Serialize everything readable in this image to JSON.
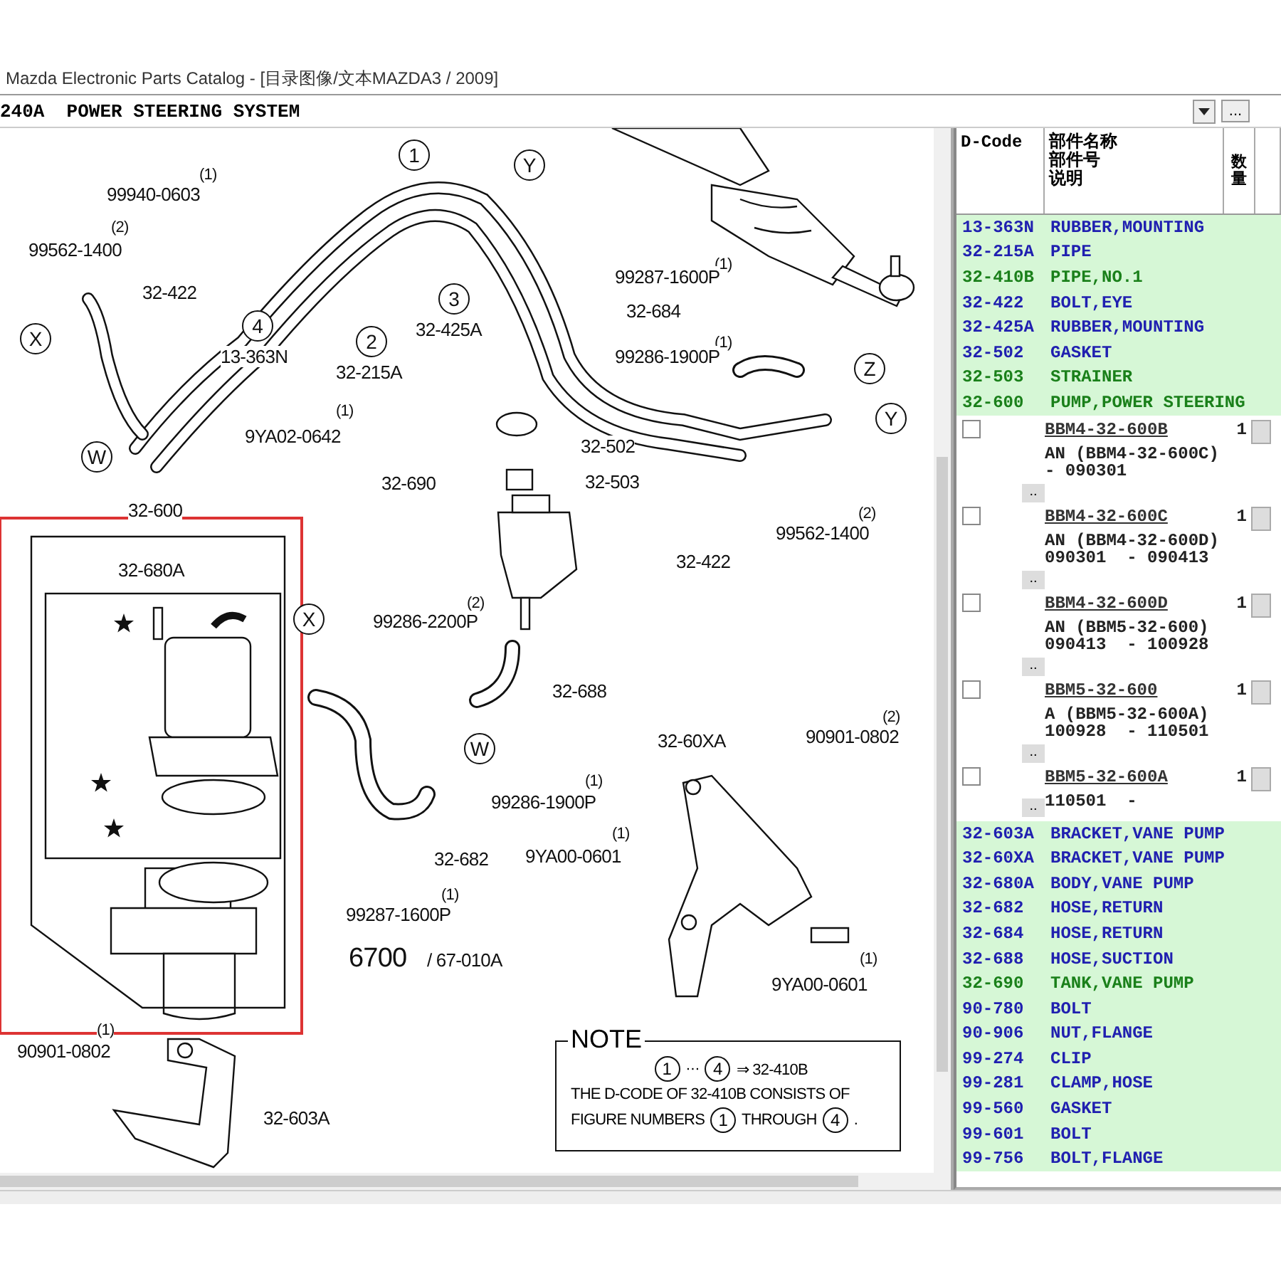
{
  "window": {
    "title": "Mazda Electronic Parts Catalog - [目录图像/文本MAZDA3 / 2009]"
  },
  "section": {
    "title": "240A  POWER STEERING SYSTEM",
    "more": "..."
  },
  "diagram": {
    "labels": [
      {
        "kind": "qty",
        "text": "(1)"
      },
      {
        "kind": "part",
        "text": "99940-0603"
      },
      {
        "kind": "qty",
        "text": "(2)"
      },
      {
        "kind": "part",
        "text": "99562-1400"
      },
      {
        "kind": "part",
        "text": "32-422"
      },
      {
        "kind": "callout",
        "text": "X"
      },
      {
        "kind": "callout",
        "text": "1"
      },
      {
        "kind": "callout",
        "text": "Y"
      },
      {
        "kind": "callout",
        "text": "4"
      },
      {
        "kind": "part",
        "text": "13-363N"
      },
      {
        "kind": "callout",
        "text": "3"
      },
      {
        "kind": "part",
        "text": "32-425A"
      },
      {
        "kind": "callout",
        "text": "2"
      },
      {
        "kind": "part",
        "text": "32-215A"
      },
      {
        "kind": "qty",
        "text": "(1)"
      },
      {
        "kind": "part",
        "text": "9YA02-0642"
      },
      {
        "kind": "callout",
        "text": "W"
      },
      {
        "kind": "qty",
        "text": "(1)"
      },
      {
        "kind": "part",
        "text": "99287-1600P"
      },
      {
        "kind": "part",
        "text": "32-684"
      },
      {
        "kind": "qty",
        "text": "(1)"
      },
      {
        "kind": "part",
        "text": "99286-1900P"
      },
      {
        "kind": "callout",
        "text": "Z"
      },
      {
        "kind": "callout",
        "text": "Y"
      },
      {
        "kind": "part",
        "text": "32-502"
      },
      {
        "kind": "part",
        "text": "32-503"
      },
      {
        "kind": "part",
        "text": "32-690"
      },
      {
        "kind": "part",
        "text": "32-422"
      },
      {
        "kind": "qty",
        "text": "(2)"
      },
      {
        "kind": "part",
        "text": "99562-1400"
      },
      {
        "kind": "part",
        "text": "32-600"
      },
      {
        "kind": "part",
        "text": "32-680A"
      },
      {
        "kind": "callout",
        "text": "X"
      },
      {
        "kind": "qty",
        "text": "(2)"
      },
      {
        "kind": "part",
        "text": "99286-2200P"
      },
      {
        "kind": "part",
        "text": "32-688"
      },
      {
        "kind": "callout",
        "text": "W"
      },
      {
        "kind": "qty",
        "text": "(1)"
      },
      {
        "kind": "part",
        "text": "99286-1900P"
      },
      {
        "kind": "part",
        "text": "32-682"
      },
      {
        "kind": "qty",
        "text": "(1)"
      },
      {
        "kind": "part",
        "text": "99287-1600P"
      },
      {
        "kind": "ref",
        "text": "6700"
      },
      {
        "kind": "part",
        "text": "/ 67-010A"
      },
      {
        "kind": "part",
        "text": "32-60XA"
      },
      {
        "kind": "qty",
        "text": "(2)"
      },
      {
        "kind": "part",
        "text": "90901-0802"
      },
      {
        "kind": "qty",
        "text": "(1)"
      },
      {
        "kind": "part",
        "text": "9YA00-0601"
      },
      {
        "kind": "qty",
        "text": "(1)"
      },
      {
        "kind": "part",
        "text": "9YA00-0601"
      },
      {
        "kind": "qty",
        "text": "(1)"
      },
      {
        "kind": "part",
        "text": "90901-0802"
      },
      {
        "kind": "part",
        "text": "32-603A"
      }
    ],
    "note": {
      "title": "NOTE",
      "lines": [
        [
          {
            "kind": "callout",
            "text": "1"
          },
          {
            "kind": "text",
            "text": "···"
          },
          {
            "kind": "callout",
            "text": "4"
          },
          {
            "kind": "text",
            "text": "⇒ 32-410B"
          }
        ],
        [
          {
            "kind": "text",
            "text": "THE D-CODE OF 32-410B CONSISTS OF"
          }
        ],
        [
          {
            "kind": "text",
            "text": "FIGURE NUMBERS"
          },
          {
            "kind": "callout",
            "text": "1"
          },
          {
            "kind": "text",
            "text": "THROUGH"
          },
          {
            "kind": "callout",
            "text": "4"
          },
          {
            "kind": "text",
            "text": "."
          }
        ]
      ]
    }
  },
  "parts_table": {
    "columns": [
      {
        "lines": [
          "D-Code"
        ]
      },
      {
        "lines": [
          "部件名称",
          "部件号",
          "说明"
        ]
      },
      {
        "lines": [
          "数量"
        ]
      }
    ],
    "rows": [
      {
        "kind": "part",
        "code": "13-363N",
        "name": "RUBBER,MOUNTING",
        "color": "#2020b0"
      },
      {
        "kind": "part",
        "code": "32-215A",
        "name": "PIPE",
        "color": "#2020b0"
      },
      {
        "kind": "part",
        "code": "32-410B",
        "name": "PIPE,NO.1",
        "color": "#1a801a"
      },
      {
        "kind": "part",
        "code": "32-422",
        "name": "BOLT,EYE",
        "color": "#2020b0"
      },
      {
        "kind": "part",
        "code": "32-425A",
        "name": "RUBBER,MOUNTING",
        "color": "#2020b0"
      },
      {
        "kind": "part",
        "code": "32-502",
        "name": "GASKET",
        "color": "#2020b0"
      },
      {
        "kind": "part",
        "code": "32-503",
        "name": "STRAINER",
        "color": "#1a801a"
      },
      {
        "kind": "part",
        "code": "32-600",
        "name": "PUMP,POWER STEERING",
        "color": "#1a801a"
      },
      {
        "kind": "variant",
        "checked": false,
        "part_no": "BBM4-32-600B",
        "qty": "1",
        "lines": [
          "AN (BBM4-32-600C)",
          "- 090301"
        ],
        "more": ".."
      },
      {
        "kind": "variant",
        "checked": false,
        "part_no": "BBM4-32-600C",
        "qty": "1",
        "lines": [
          "AN (BBM4-32-600D)",
          "090301  - 090413"
        ],
        "more": ".."
      },
      {
        "kind": "variant",
        "checked": false,
        "part_no": "BBM4-32-600D",
        "qty": "1",
        "lines": [
          "AN (BBM5-32-600)",
          "090413  - 100928"
        ],
        "more": ".."
      },
      {
        "kind": "variant",
        "checked": false,
        "part_no": "BBM5-32-600",
        "qty": "1",
        "lines": [
          "A (BBM5-32-600A)",
          "100928  - 110501"
        ],
        "more": ".."
      },
      {
        "kind": "variant",
        "checked": false,
        "part_no": "BBM5-32-600A",
        "qty": "1",
        "lines": [
          "110501  -"
        ],
        "more": ".."
      },
      {
        "kind": "part",
        "code": "32-603A",
        "name": "BRACKET,VANE PUMP",
        "color": "#2020b0"
      },
      {
        "kind": "part",
        "code": "32-60XA",
        "name": "BRACKET,VANE PUMP",
        "color": "#2020b0"
      },
      {
        "kind": "part",
        "code": "32-680A",
        "name": "BODY,VANE PUMP",
        "color": "#2020b0"
      },
      {
        "kind": "part",
        "code": "32-682",
        "name": "HOSE,RETURN",
        "color": "#2020b0"
      },
      {
        "kind": "part",
        "code": "32-684",
        "name": "HOSE,RETURN",
        "color": "#2020b0"
      },
      {
        "kind": "part",
        "code": "32-688",
        "name": "HOSE,SUCTION",
        "color": "#2020b0"
      },
      {
        "kind": "part",
        "code": "32-690",
        "name": "TANK,VANE PUMP",
        "color": "#1a801a"
      },
      {
        "kind": "part",
        "code": "90-780",
        "name": "BOLT",
        "color": "#2020b0"
      },
      {
        "kind": "part",
        "code": "90-906",
        "name": "NUT,FLANGE",
        "color": "#2020b0"
      },
      {
        "kind": "part",
        "code": "99-274",
        "name": "CLIP",
        "color": "#2020b0"
      },
      {
        "kind": "part",
        "code": "99-281",
        "name": "CLAMP,HOSE",
        "color": "#2020b0"
      },
      {
        "kind": "part",
        "code": "99-560",
        "name": "GASKET",
        "color": "#2020b0"
      },
      {
        "kind": "part",
        "code": "99-601",
        "name": "BOLT",
        "color": "#2020b0"
      },
      {
        "kind": "part",
        "code": "99-756",
        "name": "BOLT,FLANGE",
        "color": "#2020b0"
      }
    ]
  }
}
